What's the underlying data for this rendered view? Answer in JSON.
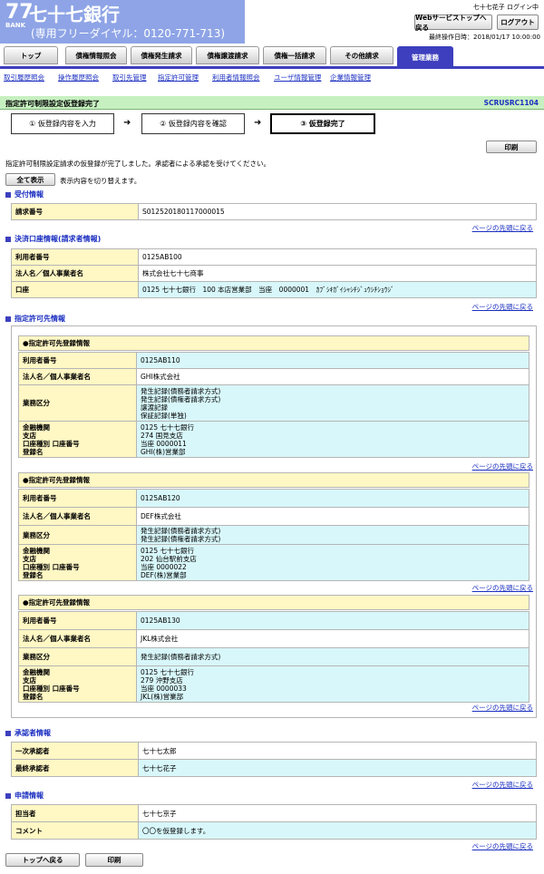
{
  "header": {
    "logo_number": "77",
    "logo_word": "BANK",
    "bank_name": "七十七銀行",
    "phone": "(専用フリーダイヤル：0120-771-713)",
    "user_status": "七十七花子 ログイン中",
    "web_top_button": "Webサービストップへ戻る",
    "logout_button": "ログアウト",
    "last_operation": "最終操作日時：2018/01/17 10:00:00"
  },
  "tabs": [
    "トップ",
    "債権情報照会",
    "債権発生請求",
    "債権譲渡請求",
    "債権一括請求",
    "その他請求",
    "管理業務"
  ],
  "subnav": [
    "取引履歴照会",
    "操作履歴照会",
    "取引先管理",
    "指定許可管理",
    "利用者情報照会",
    "ユーザ情報管理",
    "企業情報管理"
  ],
  "title": {
    "text": "指定許可制限設定仮登録完了",
    "screen_id": "SCRUSRC1104"
  },
  "steps": [
    "① 仮登録内容を入力",
    "② 仮登録内容を確認",
    "③ 仮登録完了"
  ],
  "print_label": "印刷",
  "message": "指定許可制限設定請求の仮登録が完了しました。承認者による承認を受けてください。",
  "toggle": {
    "button": "全て表示",
    "text": "表示内容を切り替えます。"
  },
  "back_to_top": "ページの先頭に戻る",
  "reception": {
    "title": "受付情報",
    "rows": [
      {
        "label": "請求番号",
        "value": "S012520180117000015"
      }
    ]
  },
  "settlement": {
    "title": "決済口座情報(請求者情報)",
    "rows": [
      {
        "label": "利用者番号",
        "value": "0125AB100"
      },
      {
        "label": "法人名／個人事業者名",
        "value": "株式会社七十七商事"
      },
      {
        "label": "口座",
        "value": "0125 七十七銀行　100 本店営業部　当座　0000001　ｶﾌﾞｼｷｶﾞｲｼｬｼﾁｼﾞｭｳｼﾁｼｮｳｼﾞ"
      }
    ]
  },
  "permit": {
    "title": "指定許可先情報",
    "group_title": "●指定許可先登録情報",
    "labels": {
      "user_no": "利用者番号",
      "corp": "法人名／個人事業者名",
      "business": "業務区分",
      "bank": "金融機関\n支店\n口座種別 口座番号\n登録名"
    },
    "entries": [
      {
        "user_no": "0125AB110",
        "corp": "GHI株式会社",
        "business": "発生記録(債務者請求方式)\n発生記録(債権者請求方式)\n譲渡記録\n保証記録(単独)",
        "bank": "0125 七十七銀行\n274 国見支店\n当座 0000011\nGHI(株)営業部"
      },
      {
        "user_no": "0125AB120",
        "corp": "DEF株式会社",
        "business": "発生記録(債務者請求方式)\n発生記録(債権者請求方式)",
        "bank": "0125 七十七銀行\n202 仙台駅前支店\n当座 0000022\nDEF(株)営業部"
      },
      {
        "user_no": "0125AB130",
        "corp": "JKL株式会社",
        "business": "発生記録(債務者請求方式)",
        "bank": "0125 七十七銀行\n279 沖野支店\n当座 0000033\nJKL(株)営業部"
      }
    ]
  },
  "approver": {
    "title": "承認者情報",
    "rows": [
      {
        "label": "一次承認者",
        "value": "七十七太郎"
      },
      {
        "label": "最終承認者",
        "value": "七十七花子"
      }
    ]
  },
  "request": {
    "title": "申請情報",
    "rows": [
      {
        "label": "担当者",
        "value": "七十七京子"
      },
      {
        "label": "コメント",
        "value": "〇〇を仮登録します。"
      }
    ]
  },
  "footer": {
    "top_button": "トップへ戻る",
    "print_button": "印刷"
  }
}
